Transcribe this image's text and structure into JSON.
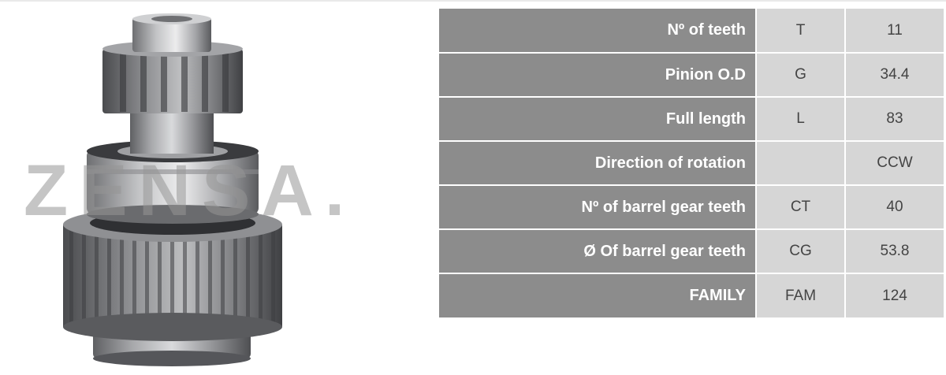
{
  "watermark": "ZENSA.",
  "product_image": "starter-drive-pinion-gear-photo",
  "colors": {
    "label_bg": "#8c8c8c",
    "label_text": "#ffffff",
    "cell_bg": "#d6d6d6",
    "cell_text": "#444444"
  },
  "specs": [
    {
      "label": "Nº of teeth",
      "code": "T",
      "value": "11"
    },
    {
      "label": "Pinion O.D",
      "code": "G",
      "value": "34.4"
    },
    {
      "label": "Full length",
      "code": "L",
      "value": "83"
    },
    {
      "label": "Direction of rotation",
      "code": "",
      "value": "CCW"
    },
    {
      "label": "Nº of barrel gear teeth",
      "code": "CT",
      "value": "40"
    },
    {
      "label": "Ø Of barrel gear teeth",
      "code": "CG",
      "value": "53.8"
    },
    {
      "label": "FAMILY",
      "code": "FAM",
      "value": "124"
    }
  ]
}
